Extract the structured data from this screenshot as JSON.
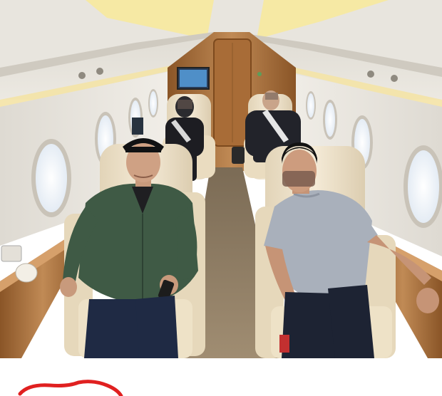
{
  "scene": {
    "kind": "photograph",
    "subject": "private-jet-cabin",
    "colors": {
      "ceiling": "#e6e3dc",
      "ceiling_light": "#f7e9a0",
      "wall": "#e9e6e0",
      "wood": "#b57a45",
      "wood_dark": "#8a5527",
      "carpet": "#8c7a62",
      "seat_leather": "#efe3cb",
      "window_glow": "#f6f9fd",
      "jacket_green": "#3f5a45",
      "tshirt_grey": "#a9b0bb",
      "pants_navy": "#1f2a44",
      "black_outfit": "#1d1d22",
      "scribble_red": "#e02020"
    }
  }
}
